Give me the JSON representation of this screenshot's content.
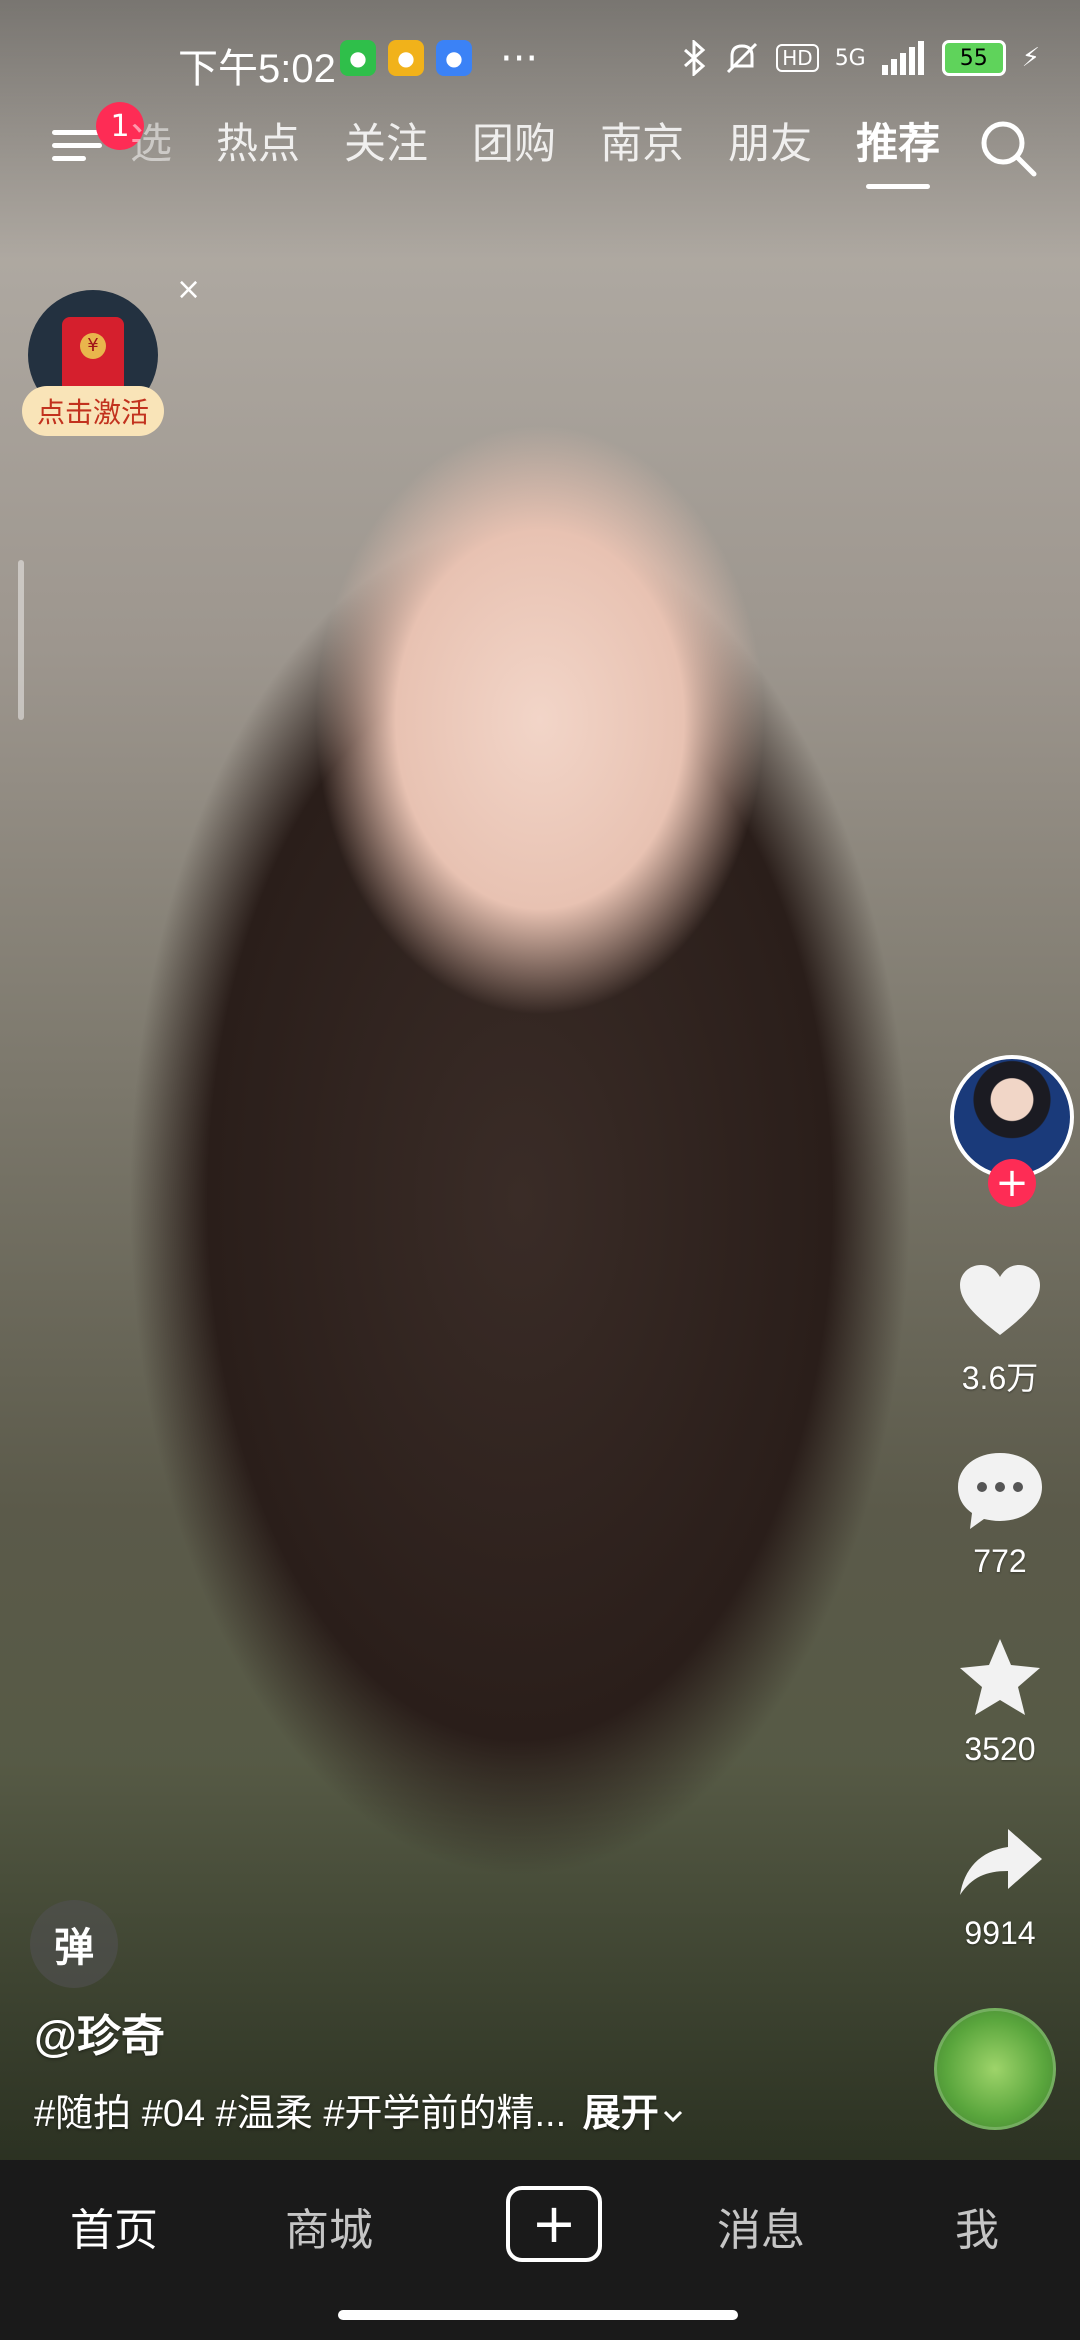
{
  "status_bar": {
    "time": "下午5:02",
    "more": "···",
    "network": "5G",
    "hd": "HD",
    "battery": "55"
  },
  "topnav": {
    "badge_count": "1",
    "tabs": [
      "选",
      "热点",
      "关注",
      "团购",
      "南京",
      "朋友",
      "推荐"
    ],
    "active_tab": "推荐"
  },
  "promo": {
    "label": "点击激活",
    "close": "×",
    "coin": "¥"
  },
  "video": {
    "author": "@珍奇",
    "description": "#随拍 #04 #温柔 #开学前的精...",
    "expand": "展开",
    "danmu": "弹"
  },
  "actions": {
    "follow": "+",
    "likes": "3.6万",
    "comments": "772",
    "favorites": "3520",
    "shares": "9914"
  },
  "bottom_nav": {
    "home": "首页",
    "mall": "商城",
    "create": "+",
    "messages": "消息",
    "me": "我"
  },
  "colors": {
    "accent": "#fe2c55",
    "tabbar_bg": "#1a1a1a",
    "promo_label_bg": "#f9e4b8"
  }
}
